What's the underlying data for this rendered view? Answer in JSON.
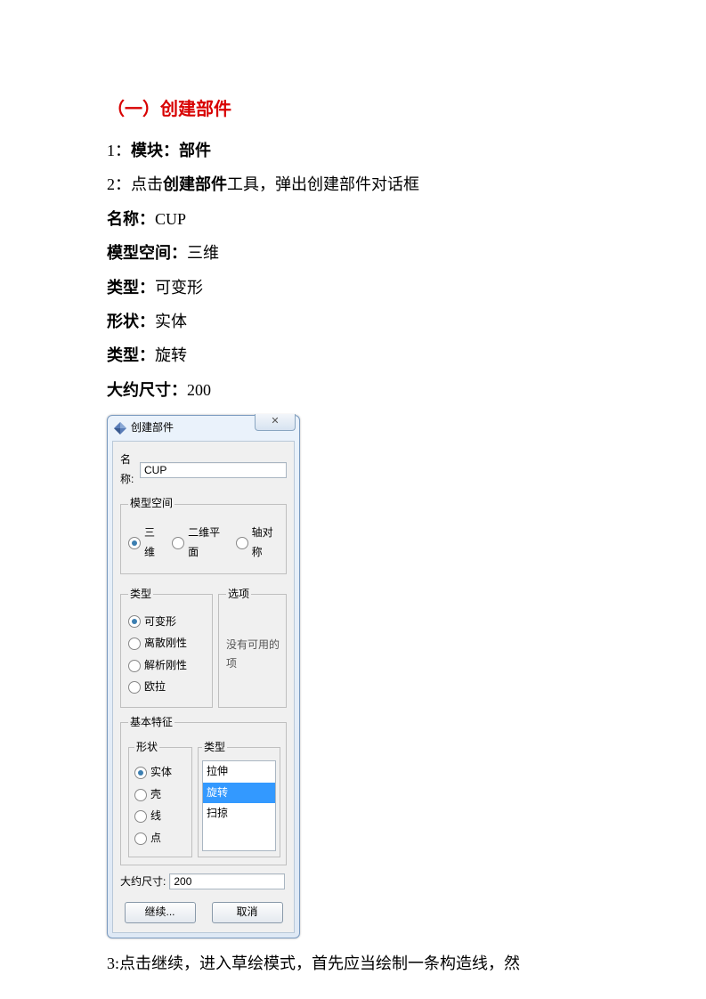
{
  "doc": {
    "section_title": "（一）创建部件",
    "line1_a": "1：",
    "line1_b": "模块：部件",
    "line2_a": "2：点击",
    "line2_b": "创建部件",
    "line2_c": "工具，弹出创建部件对话框",
    "name_lbl": "名称：",
    "name_val": "CUP",
    "mspace_lbl": "模型空间：",
    "mspace_val": "三维",
    "type_lbl": "类型：",
    "type_val": "可变形",
    "shape_lbl": "形状：",
    "shape_val": "实体",
    "type2_lbl": "类型：",
    "type2_val": "旋转",
    "size_lbl": "大约尺寸：",
    "size_val": "200",
    "line3": "3:点击继续，进入草绘模式，首先应当绘制一条构造线，然"
  },
  "dialog": {
    "title": "创建部件",
    "close_glyph": "✕",
    "name_label": "名称:",
    "name_value": "CUP",
    "modelspace_legend": "模型空间",
    "ms_options": {
      "a": "三维",
      "b": "二维平面",
      "c": "轴对称"
    },
    "type_legend": "类型",
    "options_legend": "选项",
    "options_empty": "没有可用的项",
    "type_options": {
      "a": "可变形",
      "b": "离散刚性",
      "c": "解析刚性",
      "d": "欧拉"
    },
    "basic_legend": "基本特征",
    "shape_legend": "形状",
    "list_legend": "类型",
    "shape_options": {
      "a": "实体",
      "b": "壳",
      "c": "线",
      "d": "点"
    },
    "list_items": {
      "a": "拉伸",
      "b": "旋转",
      "c": "扫掠"
    },
    "size_label": "大约尺寸:",
    "size_value": "200",
    "continue_btn": "继续...",
    "cancel_btn": "取消"
  }
}
